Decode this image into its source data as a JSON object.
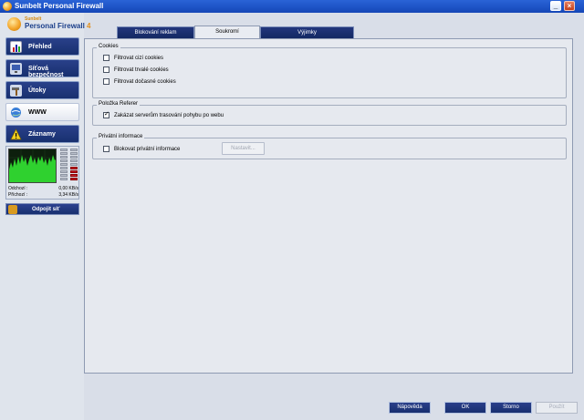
{
  "window": {
    "title": "Sunbelt Personal Firewall"
  },
  "logo": {
    "brand": "Sunbelt",
    "product": "Personal Firewall",
    "version": "4"
  },
  "nav": [
    {
      "label": "Přehled",
      "icon": "chart-icon"
    },
    {
      "label": "Síťová bezpečnost",
      "icon": "network-icon"
    },
    {
      "label": "Útoky",
      "icon": "hammer-icon"
    },
    {
      "label": "WWW",
      "icon": "globe-icon"
    },
    {
      "label": "Záznamy",
      "icon": "warning-icon"
    }
  ],
  "monitor": {
    "outgoing_label": "Odchozí :",
    "outgoing_value": "0,00 KB/s",
    "incoming_label": "Příchozí :",
    "incoming_value": "3,34 KB/s"
  },
  "disconnect_label": "Odpojit síť",
  "tabs": [
    {
      "label": "Blokování reklam",
      "active": false
    },
    {
      "label": "Soukromí",
      "active": true
    },
    {
      "label": "Výjimky",
      "active": false
    }
  ],
  "cookies": {
    "title": "Cookies",
    "options": [
      {
        "label": "Filtrovat cizí cookies",
        "checked": false
      },
      {
        "label": "Filtrovat trvalé cookies",
        "checked": false
      },
      {
        "label": "Filtrovat dočasné cookies",
        "checked": false
      }
    ]
  },
  "referer": {
    "title": "Položka Referer",
    "options": [
      {
        "label": "Zakázat serverům trasování pohybu po webu",
        "checked": true
      }
    ]
  },
  "private": {
    "title": "Privátní informace",
    "option_label": "Blokovat privátní informace",
    "checked": false,
    "settings_button": "Nastavit..."
  },
  "buttons": {
    "help": "Nápověda",
    "ok": "OK",
    "cancel": "Storno",
    "apply": "Použít"
  },
  "colors": {
    "nav_dark": "#1c3477",
    "accent_orange": "#f0a020",
    "graph_green": "#2fd12f"
  }
}
